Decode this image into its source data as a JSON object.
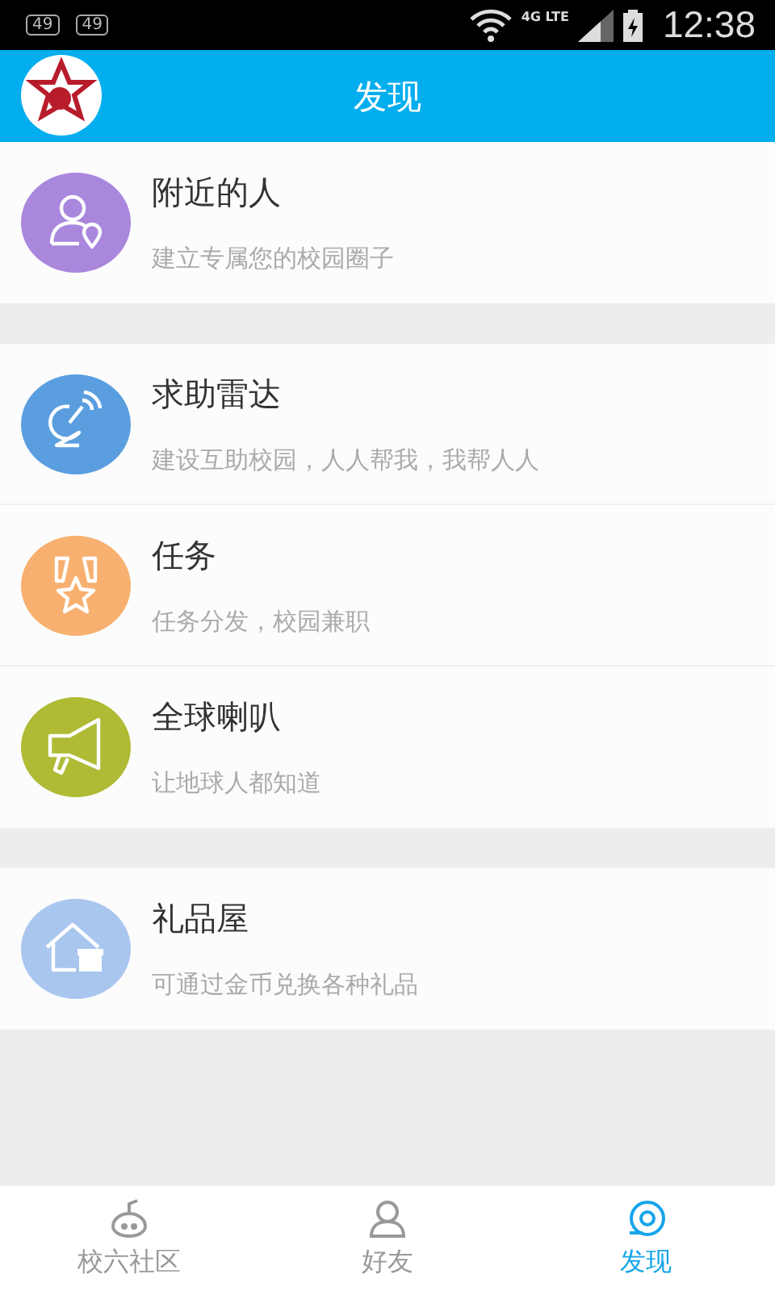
{
  "status_bar": {
    "notifications": [
      "49",
      "49"
    ],
    "network": "4G LTE",
    "time": "12:38"
  },
  "header": {
    "title": "发现"
  },
  "groups": [
    {
      "items": [
        {
          "title": "附近的人",
          "subtitle": "建立专属您的校园圈子",
          "color": "#a987dd"
        }
      ]
    },
    {
      "items": [
        {
          "title": "求助雷达",
          "subtitle": "建设互助校园，人人帮我，我帮人人",
          "color": "#5a9ee0"
        },
        {
          "title": "任务",
          "subtitle": "任务分发，校园兼职",
          "color": "#f8b070"
        },
        {
          "title": "全球喇叭",
          "subtitle": "让地球人都知道",
          "color": "#afbb35"
        }
      ]
    },
    {
      "items": [
        {
          "title": "礼品屋",
          "subtitle": "可通过金币兑换各种礼品",
          "color": "#a9c6ef"
        }
      ]
    }
  ],
  "tabs": [
    {
      "label": "校六社区",
      "selected": false
    },
    {
      "label": "好友",
      "selected": false
    },
    {
      "label": "发现",
      "selected": true
    }
  ]
}
